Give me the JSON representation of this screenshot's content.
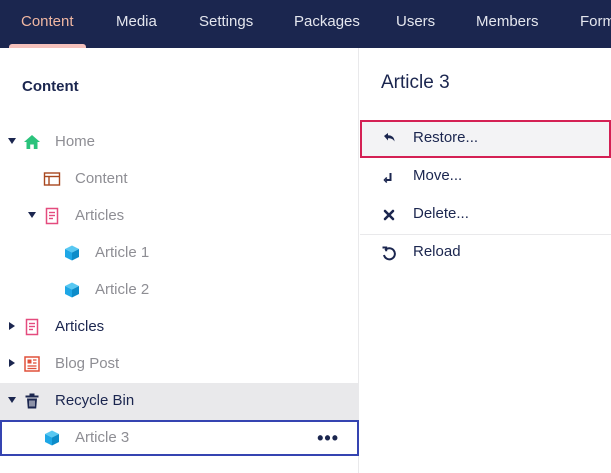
{
  "nav": {
    "items": [
      {
        "label": "Content"
      },
      {
        "label": "Media"
      },
      {
        "label": "Settings"
      },
      {
        "label": "Packages"
      },
      {
        "label": "Users"
      },
      {
        "label": "Members"
      },
      {
        "label": "Forms"
      }
    ],
    "active_index": 0
  },
  "tree": {
    "title": "Content",
    "nodes": [
      {
        "label": "Home",
        "icon": "home-icon",
        "expanded": true
      },
      {
        "label": "Content",
        "icon": "layout-icon"
      },
      {
        "label": "Articles",
        "icon": "document-icon",
        "expanded": true
      },
      {
        "label": "Article 1",
        "icon": "cube-icon"
      },
      {
        "label": "Article 2",
        "icon": "cube-icon"
      },
      {
        "label": "Articles",
        "icon": "document-icon",
        "expanded": false
      },
      {
        "label": "Blog Post",
        "icon": "newspaper-icon",
        "expanded": false
      },
      {
        "label": "Recycle Bin",
        "icon": "trash-icon",
        "expanded": true
      },
      {
        "label": "Article 3",
        "icon": "cube-icon",
        "more": "•••"
      }
    ]
  },
  "panel": {
    "title": "Article 3",
    "actions": [
      {
        "label": "Restore...",
        "icon": "undo-icon"
      },
      {
        "label": "Move...",
        "icon": "move-icon"
      },
      {
        "label": "Delete...",
        "icon": "close-icon"
      },
      {
        "label": "Reload",
        "icon": "reload-icon"
      }
    ]
  },
  "colors": {
    "nav_bg": "#1b264f",
    "nav_active": "#f0b7a2",
    "accent_red": "#d42054",
    "focus_blue": "#3544b1",
    "home_green": "#2bc37c",
    "doc_pink": "#e44b7e",
    "cube_blue": "#1ea7e6"
  }
}
